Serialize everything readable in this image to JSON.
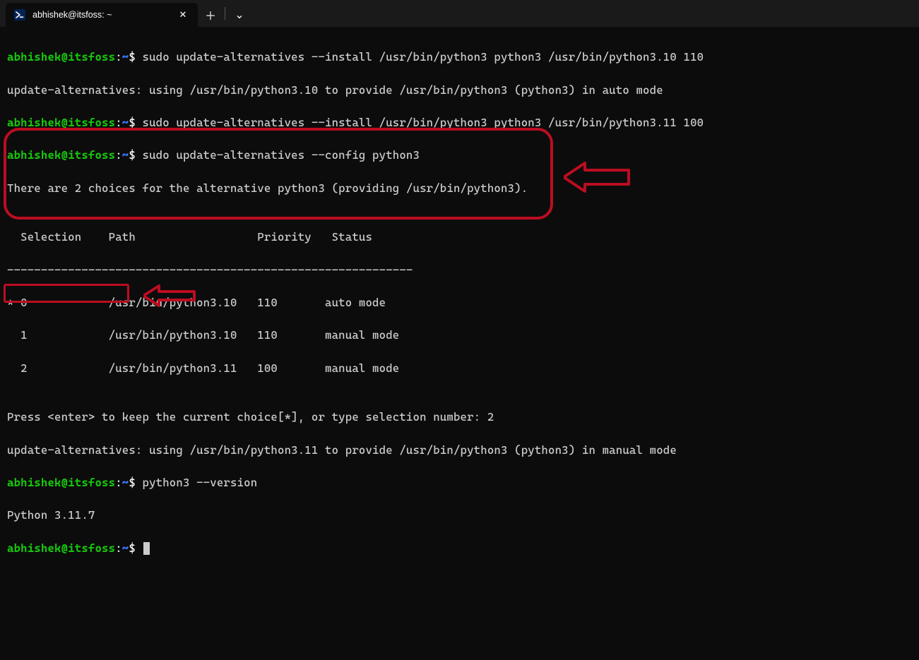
{
  "titlebar": {
    "tab_title": "abhishek@itsfoss: ~",
    "close_glyph": "✕",
    "new_tab_glyph": "＋",
    "dropdown_glyph": "⌄"
  },
  "prompt": {
    "user_host": "abhishek@itsfoss",
    "colon": ":",
    "path": "~",
    "dollar": "$"
  },
  "lines": {
    "cmd1": " sudo update-alternatives --install /usr/bin/python3 python3 /usr/bin/python3.10 110",
    "out1": "update-alternatives: using /usr/bin/python3.10 to provide /usr/bin/python3 (python3) in auto mode",
    "cmd2": " sudo update-alternatives --install /usr/bin/python3 python3 /usr/bin/python3.11 100",
    "cmd3": " sudo update-alternatives --config python3",
    "out2": "There are 2 choices for the alternative python3 (providing /usr/bin/python3).",
    "blank": "",
    "hdr": "  Selection    Path                  Priority   Status",
    "sep": "------------------------------------------------------------",
    "r0": "* 0            /usr/bin/python3.10   110       auto mode",
    "r1": "  1            /usr/bin/python3.10   110       manual mode",
    "r2": "  2            /usr/bin/python3.11   100       manual mode",
    "press": "Press <enter> to keep the current choice[*], or type selection number: 2",
    "out3": "update-alternatives: using /usr/bin/python3.11 to provide /usr/bin/python3 (python3) in manual mode",
    "cmd4": " python3 --version",
    "out4": "Python 3.11.7",
    "cmd5": " "
  },
  "chart_data": {
    "type": "table",
    "title": "update-alternatives --config python3",
    "columns": [
      "Selection",
      "Path",
      "Priority",
      "Status"
    ],
    "rows": [
      {
        "Selection": "* 0",
        "Path": "/usr/bin/python3.10",
        "Priority": 110,
        "Status": "auto mode"
      },
      {
        "Selection": "1",
        "Path": "/usr/bin/python3.10",
        "Priority": 110,
        "Status": "manual mode"
      },
      {
        "Selection": "2",
        "Path": "/usr/bin/python3.11",
        "Priority": 100,
        "Status": "manual mode"
      }
    ],
    "chosen_selection": "2",
    "resulting_version": "Python 3.11.7"
  }
}
